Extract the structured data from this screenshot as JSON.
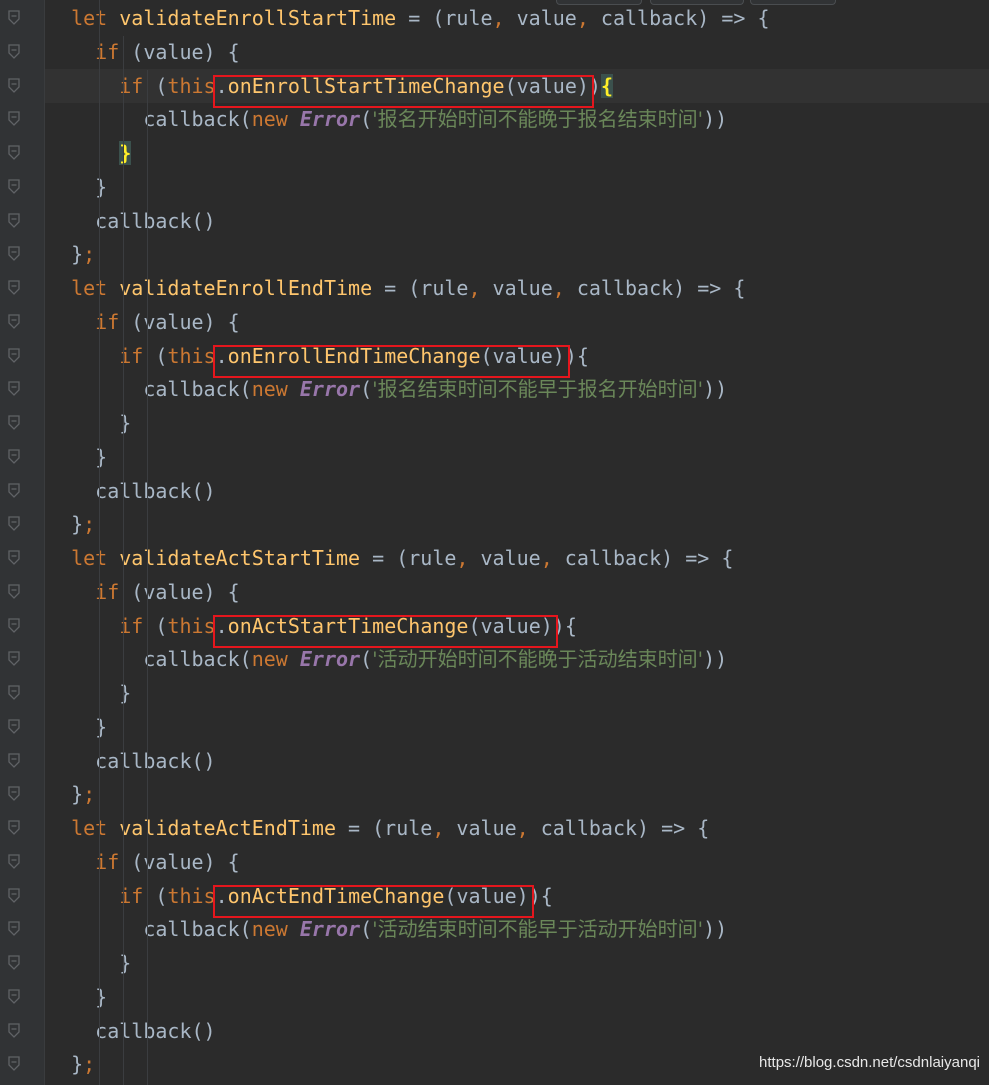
{
  "editor": {
    "language": "javascript",
    "lines": [
      {
        "indent": "  ",
        "tokens": [
          [
            "kw",
            "let "
          ],
          [
            "fn",
            "validateEnrollStartTime"
          ],
          [
            "id",
            " = (rule"
          ],
          [
            "pun",
            ","
          ],
          [
            "id",
            " value"
          ],
          [
            "pun",
            ","
          ],
          [
            "id",
            " callback) => {"
          ]
        ]
      },
      {
        "indent": "    ",
        "tokens": [
          [
            "kw",
            "if"
          ],
          [
            "id",
            " (value) {"
          ]
        ]
      },
      {
        "indent": "      ",
        "tokens": [
          [
            "kw",
            "if"
          ],
          [
            "id",
            " ("
          ],
          [
            "this",
            "this"
          ],
          [
            "id",
            "."
          ],
          [
            "call",
            "onEnrollStartTimeChange"
          ],
          [
            "id",
            "(value))"
          ],
          [
            "hl",
            "{"
          ]
        ],
        "current": true
      },
      {
        "indent": "        ",
        "tokens": [
          [
            "id",
            "callback("
          ],
          [
            "kw",
            "new "
          ],
          [
            "cls",
            "Error"
          ],
          [
            "id",
            "("
          ],
          [
            "str",
            "'报名开始时间不能晚于报名结束时间'"
          ],
          [
            "id",
            "))"
          ]
        ]
      },
      {
        "indent": "      ",
        "tokens": [
          [
            "hl",
            "}"
          ]
        ]
      },
      {
        "indent": "    ",
        "tokens": [
          [
            "id",
            "}"
          ]
        ]
      },
      {
        "indent": "    ",
        "tokens": [
          [
            "id",
            "callback()"
          ]
        ]
      },
      {
        "indent": "  ",
        "tokens": [
          [
            "id",
            "}"
          ],
          [
            "pun",
            ";"
          ]
        ]
      },
      {
        "indent": "  ",
        "tokens": [
          [
            "kw",
            "let "
          ],
          [
            "fn",
            "validateEnrollEndTime"
          ],
          [
            "id",
            " = (rule"
          ],
          [
            "pun",
            ","
          ],
          [
            "id",
            " value"
          ],
          [
            "pun",
            ","
          ],
          [
            "id",
            " callback) => {"
          ]
        ]
      },
      {
        "indent": "    ",
        "tokens": [
          [
            "kw",
            "if"
          ],
          [
            "id",
            " (value) {"
          ]
        ]
      },
      {
        "indent": "      ",
        "tokens": [
          [
            "kw",
            "if"
          ],
          [
            "id",
            " ("
          ],
          [
            "this",
            "this"
          ],
          [
            "id",
            "."
          ],
          [
            "call",
            "onEnrollEndTimeChange"
          ],
          [
            "id",
            "(value)){"
          ]
        ]
      },
      {
        "indent": "        ",
        "tokens": [
          [
            "id",
            "callback("
          ],
          [
            "kw",
            "new "
          ],
          [
            "cls",
            "Error"
          ],
          [
            "id",
            "("
          ],
          [
            "str",
            "'报名结束时间不能早于报名开始时间'"
          ],
          [
            "id",
            "))"
          ]
        ]
      },
      {
        "indent": "      ",
        "tokens": [
          [
            "id",
            "}"
          ]
        ]
      },
      {
        "indent": "    ",
        "tokens": [
          [
            "id",
            "}"
          ]
        ]
      },
      {
        "indent": "    ",
        "tokens": [
          [
            "id",
            "callback()"
          ]
        ]
      },
      {
        "indent": "  ",
        "tokens": [
          [
            "id",
            "}"
          ],
          [
            "pun",
            ";"
          ]
        ]
      },
      {
        "indent": "  ",
        "tokens": [
          [
            "kw",
            "let "
          ],
          [
            "fn",
            "validateActStartTime"
          ],
          [
            "id",
            " = (rule"
          ],
          [
            "pun",
            ","
          ],
          [
            "id",
            " value"
          ],
          [
            "pun",
            ","
          ],
          [
            "id",
            " callback) => {"
          ]
        ]
      },
      {
        "indent": "    ",
        "tokens": [
          [
            "kw",
            "if"
          ],
          [
            "id",
            " (value) {"
          ]
        ]
      },
      {
        "indent": "      ",
        "tokens": [
          [
            "kw",
            "if"
          ],
          [
            "id",
            " ("
          ],
          [
            "this",
            "this"
          ],
          [
            "id",
            "."
          ],
          [
            "call",
            "onActStartTimeChange"
          ],
          [
            "id",
            "(value)){"
          ]
        ]
      },
      {
        "indent": "        ",
        "tokens": [
          [
            "id",
            "callback("
          ],
          [
            "kw",
            "new "
          ],
          [
            "cls",
            "Error"
          ],
          [
            "id",
            "("
          ],
          [
            "str",
            "'活动开始时间不能晚于活动结束时间'"
          ],
          [
            "id",
            "))"
          ]
        ]
      },
      {
        "indent": "      ",
        "tokens": [
          [
            "id",
            "}"
          ]
        ]
      },
      {
        "indent": "    ",
        "tokens": [
          [
            "id",
            "}"
          ]
        ]
      },
      {
        "indent": "    ",
        "tokens": [
          [
            "id",
            "callback()"
          ]
        ]
      },
      {
        "indent": "  ",
        "tokens": [
          [
            "id",
            "}"
          ],
          [
            "pun",
            ";"
          ]
        ]
      },
      {
        "indent": "  ",
        "tokens": [
          [
            "kw",
            "let "
          ],
          [
            "fn",
            "validateActEndTime"
          ],
          [
            "id",
            " = (rule"
          ],
          [
            "pun",
            ","
          ],
          [
            "id",
            " value"
          ],
          [
            "pun",
            ","
          ],
          [
            "id",
            " callback) => {"
          ]
        ]
      },
      {
        "indent": "    ",
        "tokens": [
          [
            "kw",
            "if"
          ],
          [
            "id",
            " (value) {"
          ]
        ]
      },
      {
        "indent": "      ",
        "tokens": [
          [
            "kw",
            "if"
          ],
          [
            "id",
            " ("
          ],
          [
            "this",
            "this"
          ],
          [
            "id",
            "."
          ],
          [
            "call",
            "onActEndTimeChange"
          ],
          [
            "id",
            "(value)){"
          ]
        ]
      },
      {
        "indent": "        ",
        "tokens": [
          [
            "id",
            "callback("
          ],
          [
            "kw",
            "new "
          ],
          [
            "cls",
            "Error"
          ],
          [
            "id",
            "("
          ],
          [
            "str",
            "'活动结束时间不能早于活动开始时间'"
          ],
          [
            "id",
            "))"
          ]
        ]
      },
      {
        "indent": "      ",
        "tokens": [
          [
            "id",
            "}"
          ]
        ]
      },
      {
        "indent": "    ",
        "tokens": [
          [
            "id",
            "}"
          ]
        ]
      },
      {
        "indent": "    ",
        "tokens": [
          [
            "id",
            "callback()"
          ]
        ]
      },
      {
        "indent": "  ",
        "tokens": [
          [
            "id",
            "}"
          ],
          [
            "pun",
            ";"
          ]
        ]
      }
    ]
  },
  "watermark": "https://blog.csdn.net/csdnlaiyanqi",
  "colors": {
    "background": "#2b2b2b",
    "gutter": "#313335",
    "keyword": "#cc7832",
    "function": "#ffc66d",
    "string": "#6a8759",
    "class": "#9876aa",
    "annotation_box": "#e5161d"
  }
}
